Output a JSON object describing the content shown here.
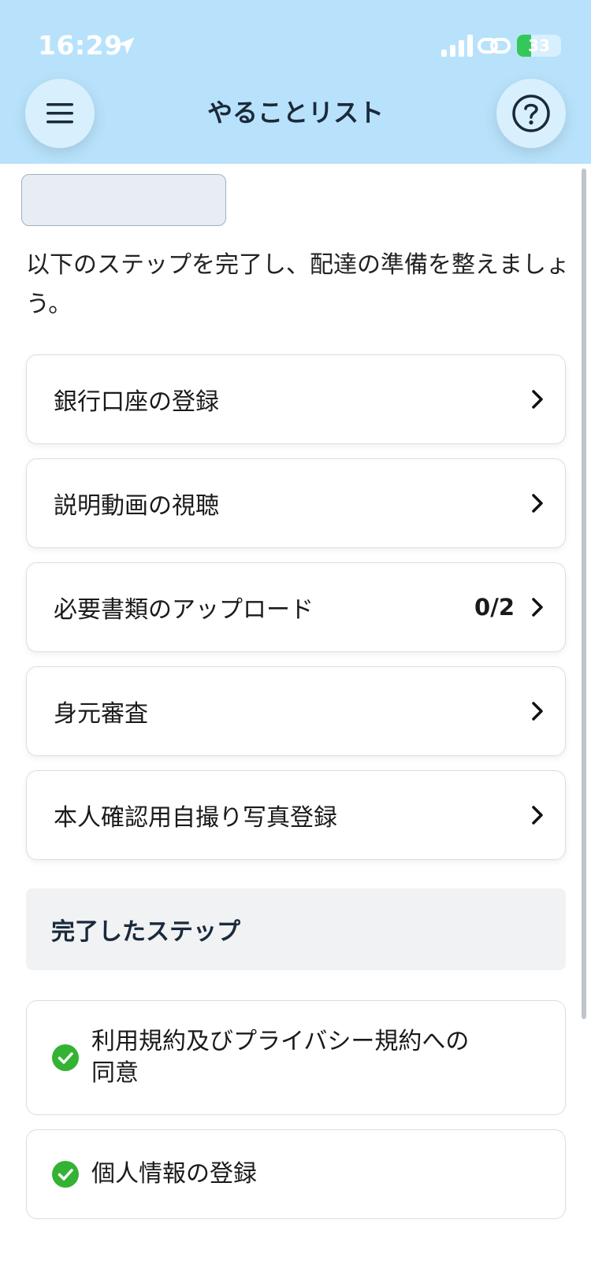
{
  "status_bar": {
    "time": "16:29",
    "battery_level": "33",
    "battery_fill_fraction": 0.33,
    "icons": [
      "location-arrow-icon",
      "signal-icon",
      "link-icon",
      "battery-icon"
    ]
  },
  "header": {
    "title": "やることリスト",
    "menu_icon": "hamburger-menu-icon",
    "help_icon": "help-circle-icon"
  },
  "intro_text": "以下のステップを完了し、配達の準備を整えましょう。",
  "todo_steps": [
    {
      "label": "銀行口座の登録",
      "count": ""
    },
    {
      "label": "説明動画の視聴",
      "count": ""
    },
    {
      "label": "必要書類のアップロード",
      "count": "0/2"
    },
    {
      "label": "身元審査",
      "count": ""
    },
    {
      "label": "本人確認用自撮り写真登録",
      "count": ""
    }
  ],
  "completed_section": {
    "title": "完了したステップ",
    "items": [
      {
        "label": "利用規約及びプライバシー規約への同意"
      },
      {
        "label": "個人情報の登録"
      }
    ]
  },
  "colors": {
    "header_bg": "#b8e2fb",
    "check_green": "#34b233",
    "battery_green": "#34c759"
  }
}
